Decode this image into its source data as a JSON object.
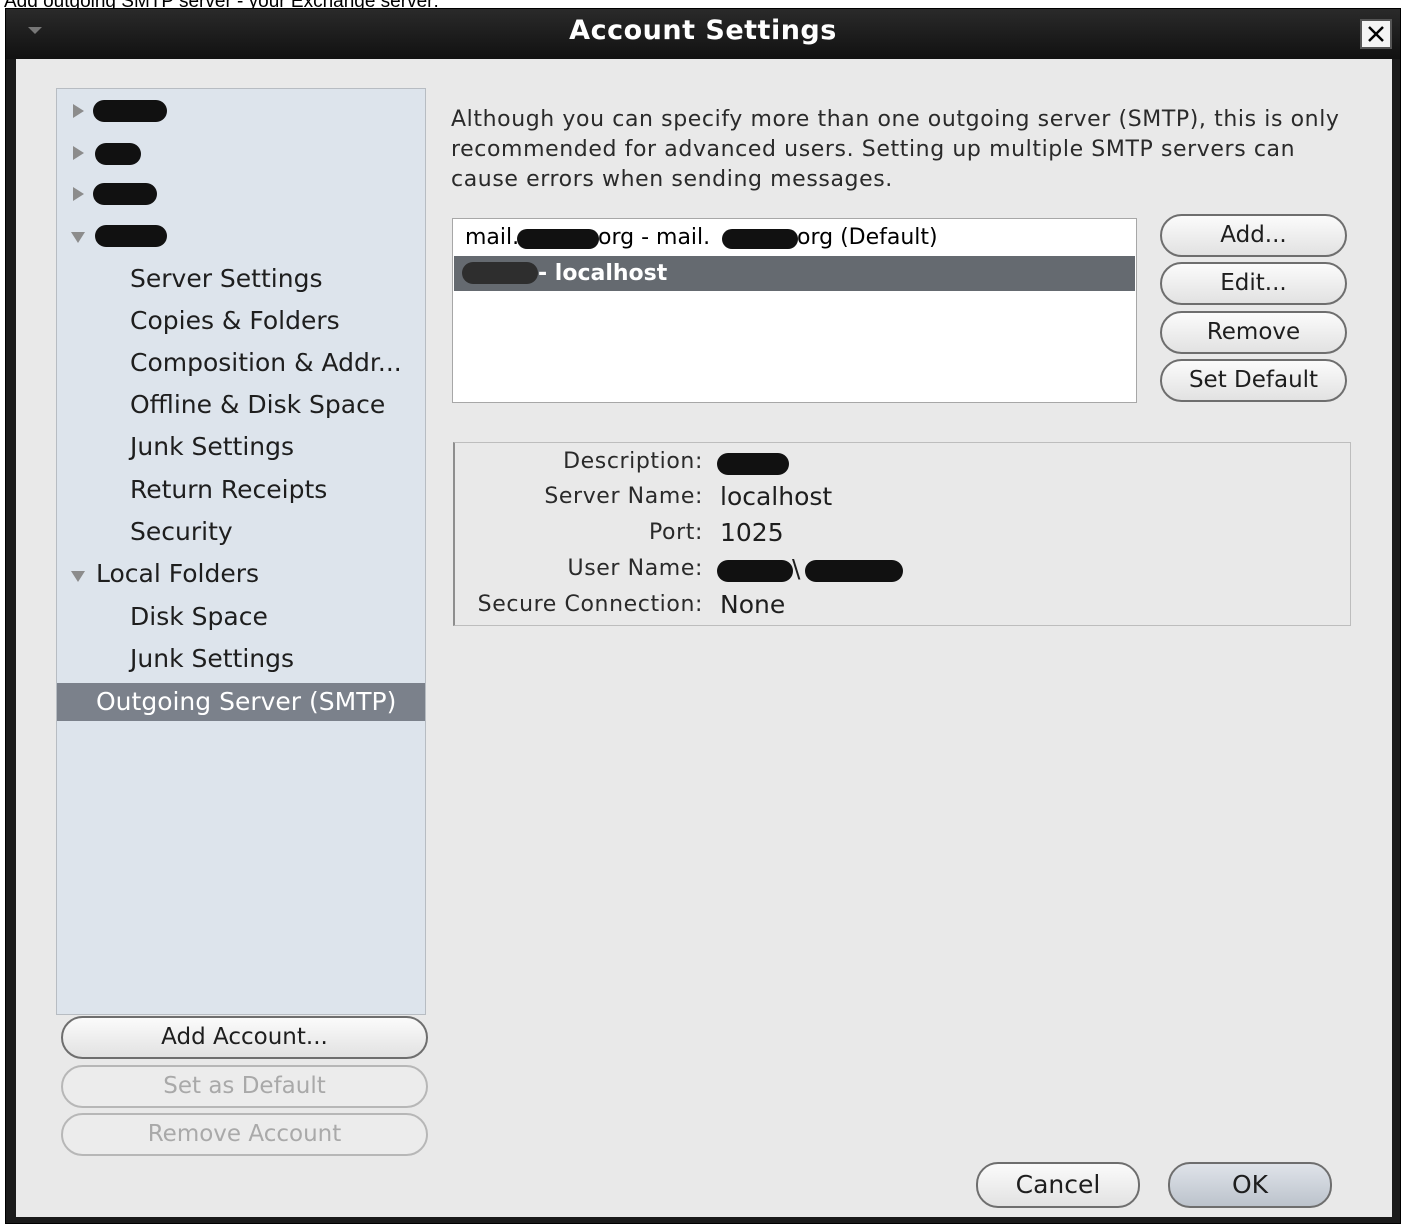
{
  "caption": "Add outgoing SMTP server - your Exchange server:",
  "window": {
    "title": "Account Settings"
  },
  "tree": {
    "accounts": [
      {
        "label": ""
      },
      {
        "label": ""
      },
      {
        "label": ""
      },
      {
        "label": ""
      }
    ],
    "account_items": [
      "Server Settings",
      "Copies & Folders",
      "Composition & Addr...",
      "Offline & Disk Space",
      "Junk Settings",
      "Return Receipts",
      "Security"
    ],
    "local_folders": "Local Folders",
    "local_items": [
      "Disk Space",
      "Junk Settings"
    ],
    "outgoing": "Outgoing Server (SMTP)"
  },
  "left_buttons": {
    "add_account": "Add Account...",
    "set_default": "Set as Default",
    "remove_account": "Remove Account"
  },
  "description": "Although you can specify more than one outgoing server (SMTP), this is only recommended for advanced users. Setting up multiple SMTP servers can cause errors when sending messages.",
  "smtp_list": {
    "row1_prefix": "mail.",
    "row1_mid": "org - mail.",
    "row1_suffix": "org (Default)",
    "row2_suffix": " - localhost"
  },
  "smtp_buttons": {
    "add": "Add...",
    "edit": "Edit...",
    "remove": "Remove",
    "set_default": "Set Default"
  },
  "details": {
    "description_label": "Description:",
    "server_label": "Server Name:",
    "server_value": "localhost",
    "port_label": "Port:",
    "port_value": "1025",
    "user_label": "User Name:",
    "user_sep": "\\",
    "secure_label": "Secure Connection:",
    "secure_value": "None"
  },
  "dialog_buttons": {
    "cancel": "Cancel",
    "ok": "OK"
  }
}
